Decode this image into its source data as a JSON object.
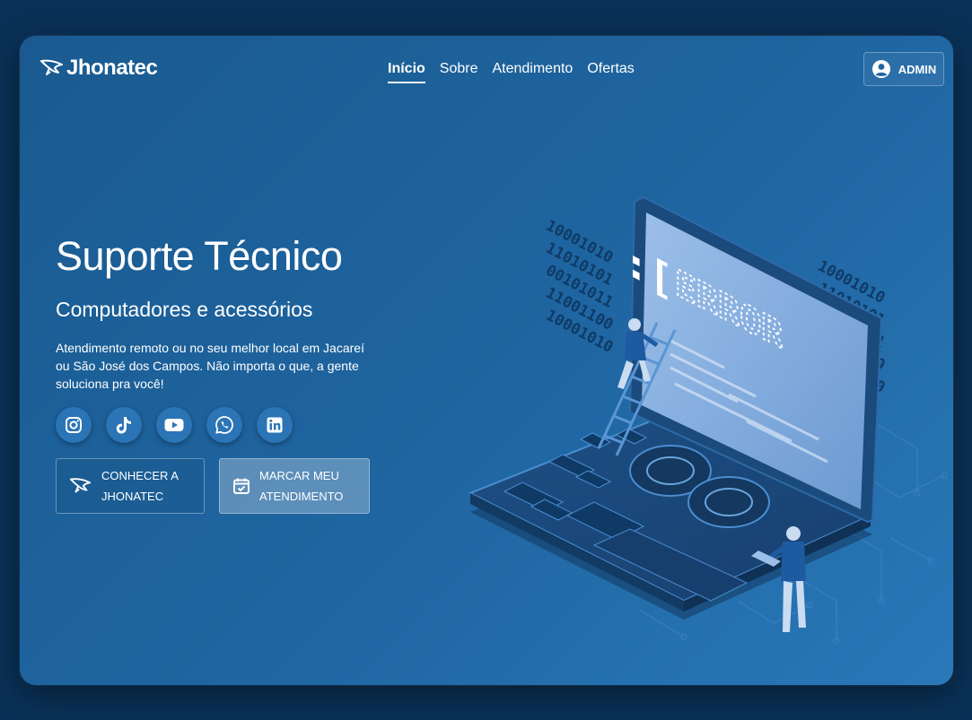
{
  "brand": {
    "name": "Jhonatec"
  },
  "nav": {
    "items": [
      {
        "label": "Início",
        "active": true
      },
      {
        "label": "Sobre",
        "active": false
      },
      {
        "label": "Atendimento",
        "active": false
      },
      {
        "label": "Ofertas",
        "active": false
      }
    ],
    "admin_label": "ADMIN"
  },
  "hero": {
    "title": "Suporte Técnico",
    "subtitle": "Computadores e acessórios",
    "description": "Atendimento remoto ou no seu melhor local em Jacareí ou São José dos Campos. Não importa o que, a gente soluciona pra você!",
    "socials": [
      "instagram-icon",
      "tiktok-icon",
      "youtube-icon",
      "whatsapp-icon",
      "linkedin-icon"
    ],
    "buttons": {
      "about": "CONHECER A JHONATEC",
      "schedule": "MARCAR MEU ATENDIMENTO"
    }
  },
  "illustration": {
    "screen_text": "ERROR",
    "binary_left": [
      "10001010",
      "11010101",
      "00101011",
      "11001100",
      "10001010"
    ],
    "binary_right": [
      "10001010",
      "11010101",
      "00101011",
      "11001100",
      "10001010"
    ]
  },
  "colors": {
    "background": "#0a3258",
    "card": "#1f66a2",
    "accent": "#2b74b6"
  }
}
